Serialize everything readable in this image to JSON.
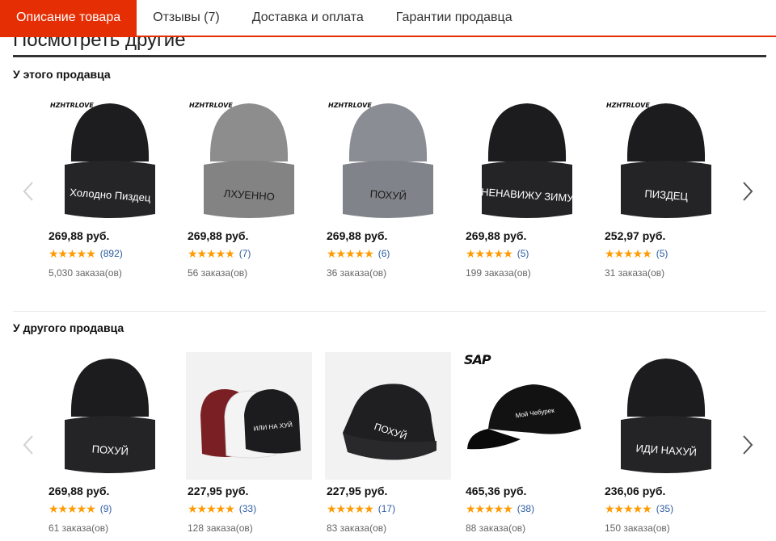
{
  "tabs": [
    {
      "label": "Описание товара",
      "active": true
    },
    {
      "label": "Отзывы (7)",
      "active": false
    },
    {
      "label": "Доставка и оплата",
      "active": false
    },
    {
      "label": "Гарантии продавца",
      "active": false
    }
  ],
  "heading": "Посмотреть другие",
  "sections": [
    {
      "title": "У этого продавца",
      "products": [
        {
          "brand": "HZHTRLOVE",
          "hat_text": "Холодно Пиздец",
          "hat_color": "#1d1d1f",
          "price": "269,88 руб.",
          "stars": "★★★★★",
          "reviews": "(892)",
          "orders": "5,030 заказа(ов)"
        },
        {
          "brand": "HZHTRLOVE",
          "hat_text": "ЛХУЕННО",
          "hat_color": "#8d8d8d",
          "price": "269,88 руб.",
          "stars": "★★★★★",
          "reviews": "(7)",
          "orders": "56 заказа(ов)"
        },
        {
          "brand": "HZHTRLOVE",
          "hat_text": "ПОХУЙ",
          "hat_color": "#8a8e94",
          "price": "269,88 руб.",
          "stars": "★★★★★",
          "reviews": "(6)",
          "orders": "36 заказа(ов)"
        },
        {
          "brand": "",
          "hat_text": "НЕНАВИЖУ ЗИМУ",
          "hat_color": "#1c1c1e",
          "price": "269,88 руб.",
          "stars": "★★★★★",
          "reviews": "(5)",
          "orders": "199 заказа(ов)"
        },
        {
          "brand": "HZHTRLOVE",
          "hat_text": "ПИЗДЕЦ",
          "hat_color": "#1c1c1e",
          "price": "252,97 руб.",
          "stars": "★★★★★",
          "reviews": "(5)",
          "orders": "31 заказа(ов)"
        }
      ]
    },
    {
      "title": "У другого продавца",
      "products": [
        {
          "brand": "",
          "hat_text": "ПОХУЙ",
          "hat_color": "#1c1c1e",
          "price": "269,88 руб.",
          "stars": "★★★★★",
          "reviews": "(9)",
          "orders": "61 заказа(ов)"
        },
        {
          "brand": "",
          "hat_text": "ИЛИ НА ХУЙ",
          "hat_color": "#1c1c1e",
          "price": "227,95 руб.",
          "stars": "★★★★★",
          "reviews": "(33)",
          "orders": "128 заказа(ов)"
        },
        {
          "brand": "",
          "hat_text": "ПОХУЙ",
          "hat_color": "#1f1f21",
          "price": "227,95 руб.",
          "stars": "★★★★★",
          "reviews": "(17)",
          "orders": "83 заказа(ов)"
        },
        {
          "brand": "SAP",
          "hat_text": "Мой Чебурек",
          "hat_color": "#121212",
          "price": "465,36 руб.",
          "stars": "★★★★★",
          "reviews": "(38)",
          "orders": "88 заказа(ов)"
        },
        {
          "brand": "",
          "hat_text": "ИДИ НАХУЙ",
          "hat_color": "#1c1c1e",
          "price": "236,06 руб.",
          "stars": "★★★★★",
          "reviews": "(35)",
          "orders": "150 заказа(ов)"
        }
      ]
    }
  ],
  "icons": {
    "prev": "chevron-left-icon",
    "next": "chevron-right-icon"
  },
  "colors": {
    "accent": "#e62e04",
    "star": "#ff9a00",
    "link": "#2d5da1"
  }
}
